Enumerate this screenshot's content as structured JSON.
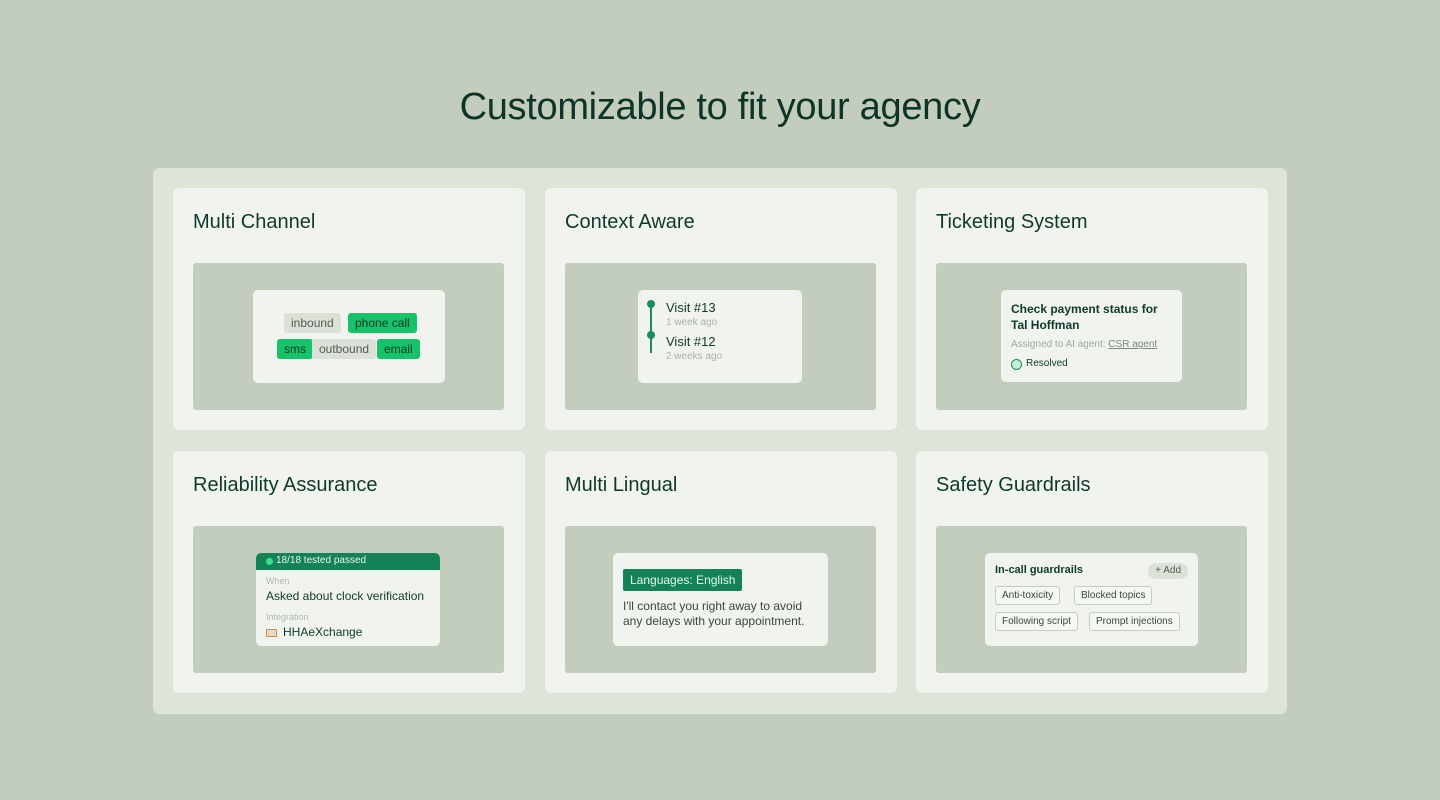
{
  "headline": "Customizable to fit your agency",
  "cards": {
    "multi_channel": {
      "title": "Multi Channel",
      "chips": [
        {
          "label": "inbound",
          "active": false
        },
        {
          "label": "phone call",
          "active": true
        },
        {
          "label": "sms",
          "active": true
        },
        {
          "label": "outbound",
          "active": false
        },
        {
          "label": "email",
          "active": true
        }
      ]
    },
    "context_aware": {
      "title": "Context Aware",
      "visits": [
        {
          "title": "Visit #13",
          "time": "1 week ago"
        },
        {
          "title": "Visit #12",
          "time": "2 weeks ago"
        }
      ]
    },
    "ticketing": {
      "title": "Ticketing System",
      "ticket_title": "Check payment status for Tal Hoffman",
      "assigned_prefix": "Assigned to AI agent:",
      "assigned_agent": "CSR agent",
      "status": "Resolved"
    },
    "reliability": {
      "title": "Reliability Assurance",
      "tests_passed": "18/18 tested passed",
      "when_label": "When",
      "when_value": "Asked about clock verification",
      "integration_label": "Integration",
      "integration_value": "HHAeXchange"
    },
    "multi_lingual": {
      "title": "Multi Lingual",
      "language_badge": "Languages: English",
      "message": "I'll contact you right away to avoid any delays with your appointment."
    },
    "safety": {
      "title": "Safety Guardrails",
      "section_title": "In-call guardrails",
      "add_label": "+ Add",
      "tags": [
        "Anti-toxicity",
        "Blocked topics",
        "Following script",
        "Prompt injections"
      ]
    }
  },
  "colors": {
    "page_bg": "#c3cdbd",
    "panel_bg": "#dde4d8",
    "card_bg": "#f0f3ee",
    "accent_green": "#16c26a",
    "dark_green": "#138357",
    "text_dark": "#0f3a2b"
  },
  "icons": {
    "status": "resolved-circle-icon",
    "integration": "hhaexchange-logo-icon",
    "test_status": "status-dot-icon",
    "timeline": "timeline-dot-icon"
  }
}
